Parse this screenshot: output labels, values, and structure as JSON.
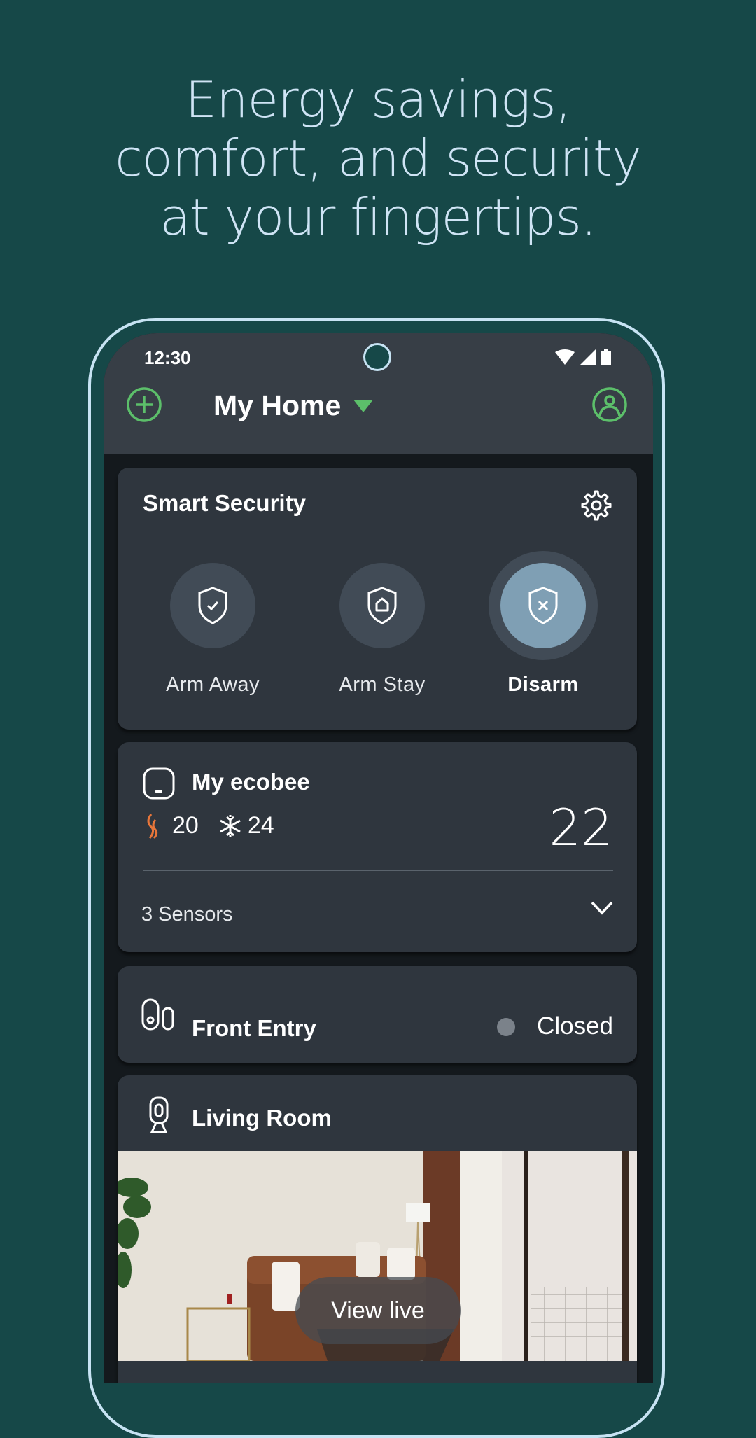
{
  "headline": {
    "lines": [
      "Energy savings,",
      "comfort, and security",
      "at your fingertips."
    ]
  },
  "status_bar": {
    "time": "12:30",
    "icons": [
      "wifi-icon",
      "signal-icon",
      "battery-icon"
    ]
  },
  "header": {
    "add_icon": "plus-circle-icon",
    "home_name": "My Home",
    "dropdown_icon": "triangle-down-icon",
    "profile_icon": "profile-icon",
    "accent_color": "#5cbf6a"
  },
  "security": {
    "title": "Smart Security",
    "settings_icon": "gear-icon",
    "modes": [
      {
        "label": "Arm Away",
        "icon": "shield-check-icon",
        "active": false
      },
      {
        "label": "Arm Stay",
        "icon": "shield-home-icon",
        "active": false
      },
      {
        "label": "Disarm",
        "icon": "shield-x-icon",
        "active": true
      }
    ]
  },
  "thermostat": {
    "title": "My ecobee",
    "heat_setpoint": "20",
    "cool_setpoint": "24",
    "current_temp": "22",
    "sensors_label": "3 Sensors",
    "heat_color": "#e8763a"
  },
  "door_sensor": {
    "title": "Front Entry",
    "status": "Closed"
  },
  "camera": {
    "title": "Living Room",
    "view_live_label": "View live"
  }
}
